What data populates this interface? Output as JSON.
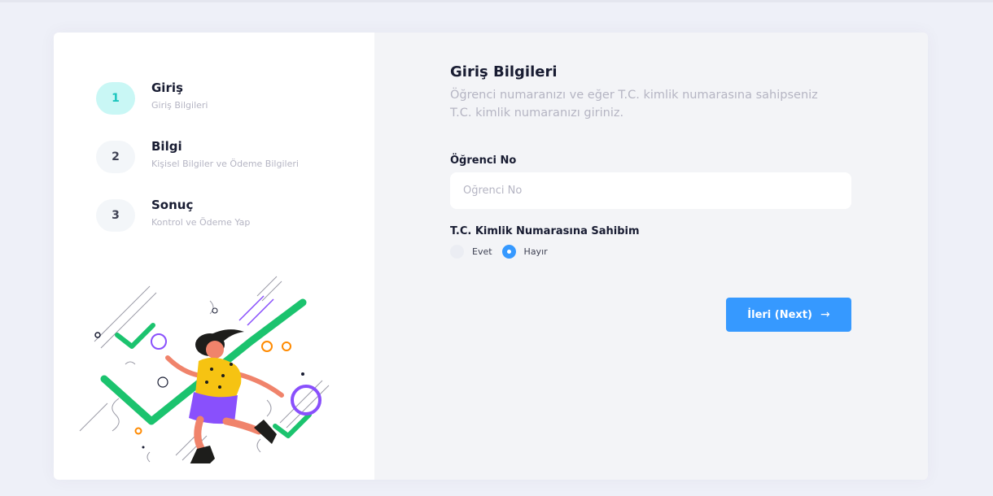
{
  "wizard": {
    "steps": [
      {
        "number": "1",
        "title": "Giriş",
        "subtitle": "Giriş Bilgileri"
      },
      {
        "number": "2",
        "title": "Bilgi",
        "subtitle": "Kişisel Bilgiler ve Ödeme Bilgileri"
      },
      {
        "number": "3",
        "title": "Sonuç",
        "subtitle": "Kontrol ve Ödeme Yap"
      }
    ],
    "active_step": 1
  },
  "form": {
    "title": "Giriş Bilgileri",
    "description": "Öğrenci numaranızı ve eğer T.C. kimlik numarasına sahipseniz T.C. kimlik numaranızı giriniz.",
    "student_no": {
      "label": "Öğrenci No",
      "placeholder": "Öğrenci No",
      "value": ""
    },
    "tc_question": {
      "label": "T.C. Kimlik Numarasına Sahibim",
      "options": [
        "Evet",
        "Hayır"
      ],
      "selected": "Hayır"
    },
    "next_button": {
      "label": "İleri (Next)",
      "arrow": "→"
    }
  },
  "colors": {
    "primary": "#3699ff",
    "active_step_bg": "#c9f7f5",
    "active_step_text": "#1bc5bd",
    "illustration_green": "#1bc36e",
    "illustration_purple": "#8950fc",
    "illustration_orange": "#ff8a00",
    "illustration_yellow": "#f6c312"
  }
}
